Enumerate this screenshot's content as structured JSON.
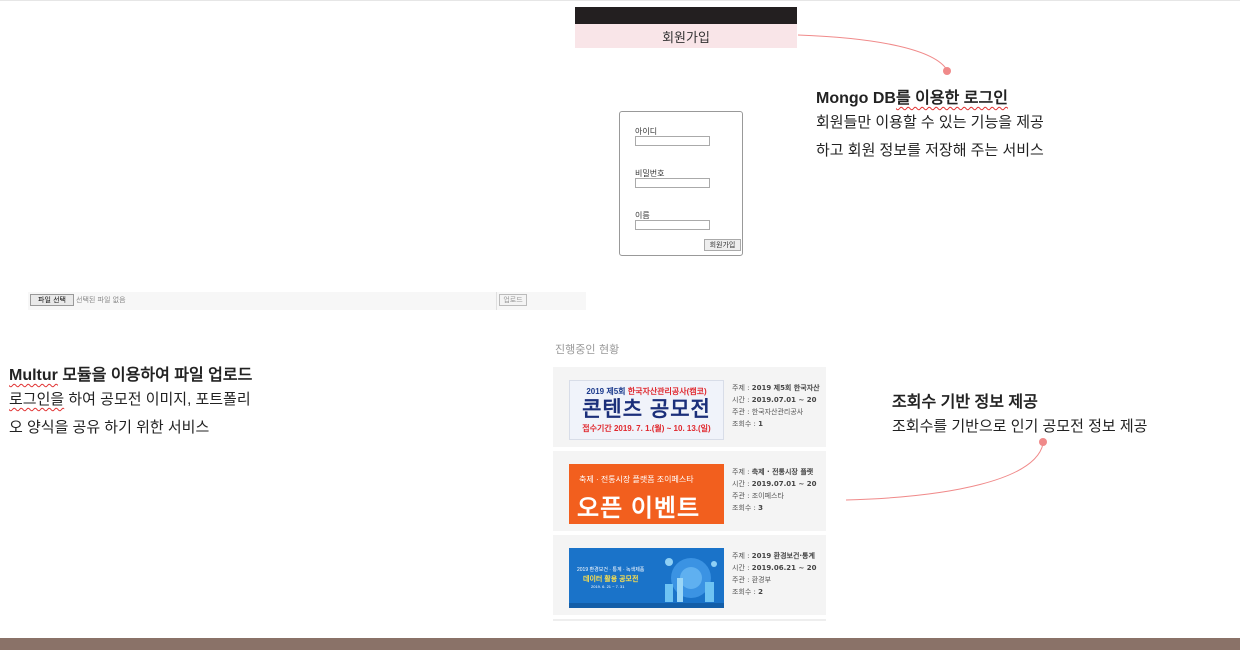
{
  "signup_banner": {
    "label": "회원가입"
  },
  "login_feature": {
    "title_prefix": "Mongo DB",
    "title_rest": "를 이용한 로그인",
    "line1": "회원들만 이용할 수 있는 기능을 제공",
    "line2": "하고 회원 정보를 저장해 주는 서비스"
  },
  "signup_form": {
    "id_label": "아이디",
    "password_label": "비밀번호",
    "name_label": "이름",
    "submit_label": "회원가입"
  },
  "upload_bar": {
    "choose_file_label": "파일 선택",
    "no_file_text": "선택된 파일 없음",
    "upload_label": "업로드"
  },
  "upload_feature": {
    "title_prefix": "Multur",
    "title_rest": " 모듈을 이용하여 파일 업로드",
    "line1_prefix": "로그인을",
    "line1_rest": " 하여 공모전 이미지, 포트폴리",
    "line2": "오 양식을 공유 하기 위한 서비스"
  },
  "progress_section": {
    "label": "진행중인 현황"
  },
  "contests": [
    {
      "poster": {
        "line1_a": "2019 제5회 ",
        "line1_b": "한국자산관리공사(캠코)",
        "line2": "콘텐츠 공모전",
        "line3": "접수기간 2019. 7. 1.(월) ~ 10. 13.(일)"
      },
      "subject_label": "주제 : ",
      "subject": "2019 제5회 한국자산",
      "time_label": "시간 : ",
      "time": "2019.07.01 ~ 20",
      "host_label": "주관 : ",
      "host": "한국자산관리공사",
      "views_label": "조회수 : ",
      "views": "1"
    },
    {
      "poster": {
        "line1": "축제 · 전통시장 플랫폼 조이페스타",
        "line2": "오픈 이벤트"
      },
      "subject_label": "주제 : ",
      "subject": "축제 · 전통시장 플랫",
      "time_label": "시간 : ",
      "time": "2019.07.01 ~ 20",
      "host_label": "주관 : ",
      "host": "조이페스타",
      "views_label": "조회수 : ",
      "views": "3"
    },
    {
      "poster": {
        "line1": "2019 환경보건 · 통계 · 녹색제품",
        "line2": "데이터 활용 공모전",
        "line3": "2019. 6. 21 ~ 7. 31"
      },
      "subject_label": "주제 : ",
      "subject": "2019 환경보건·통계",
      "time_label": "시간 : ",
      "time": "2019.06.21 ~ 20",
      "host_label": "주관 : ",
      "host": "환경부",
      "views_label": "조회수 : ",
      "views": "2"
    }
  ],
  "views_feature": {
    "title": "조회수 기반 정보 제공",
    "line1": "조회수를 기반으로 인기 공모전 정보 제공"
  },
  "colors": {
    "accent_dot": "#f08a8a",
    "banner_pink": "#f9e5e8",
    "banner_dark": "#231f20",
    "footer": "#8a7268"
  }
}
